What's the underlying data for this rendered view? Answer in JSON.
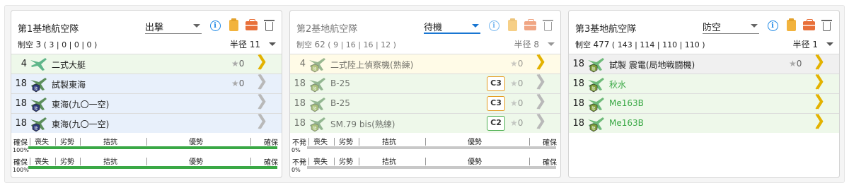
{
  "colors": {
    "gold": "#e3b200",
    "silver": "#b9b9b9",
    "green_bar": "#3aa845",
    "grey_bar": "#c8c8c8",
    "blue_row": "#e8f0fb",
    "green_row": "#eef8ea",
    "yellow_row": "#fffbe7",
    "grey_row": "#f0f0f0"
  },
  "bar_labels": {
    "left": "喪失",
    "l2": "劣勢",
    "mid": "拮抗",
    "m2": "優勢",
    "right": "確保"
  },
  "panels": [
    {
      "title": "第1基地航空隊",
      "mode": "出撃",
      "active": false,
      "air_label": "制空",
      "air_value": "3",
      "air_detail": "( 3 | 0 | 0 | 0 )",
      "radius_label": "半径",
      "radius_value": "11",
      "slots": [
        {
          "count": "4",
          "name": "二式大艇",
          "stars": "0",
          "row": "green",
          "icon": "flying-boat-icon",
          "prof": "gold"
        },
        {
          "count": "18",
          "name": "試製東海",
          "stars": "0",
          "row": "blue",
          "icon": "patrol-plane-icon",
          "prof": "silver"
        },
        {
          "count": "18",
          "name": "東海(九〇一空)",
          "stars": "",
          "row": "blue",
          "icon": "patrol-plane-icon",
          "prof": "silver"
        },
        {
          "count": "18",
          "name": "東海(九〇一空)",
          "stars": "",
          "row": "blue",
          "icon": "patrol-plane-icon",
          "prof": "silver"
        }
      ],
      "bars": [
        {
          "status": "確保",
          "pct": "100%",
          "fill": 1.0,
          "color": "#3aa845"
        },
        {
          "status": "確保",
          "pct": "100%",
          "fill": 1.0,
          "color": "#3aa845"
        }
      ]
    },
    {
      "title": "第2基地航空隊",
      "mode": "待機",
      "active": true,
      "air_label": "制空",
      "air_value": "62",
      "air_detail": "( 9 | 16 | 16 | 12 )",
      "radius_label": "半径",
      "radius_value": "8",
      "slots": [
        {
          "count": "4",
          "name": "二式陸上偵察機(熟練)",
          "stars": "0",
          "row": "yellow",
          "icon": "recon-plane-icon",
          "prof": "gold"
        },
        {
          "count": "18",
          "name": "B-25",
          "stars": "0",
          "row": "green",
          "icon": "land-bomber-icon",
          "prof": "silver",
          "badge": "C3",
          "badge_color": "#e39a1f"
        },
        {
          "count": "18",
          "name": "B-25",
          "stars": "0",
          "row": "green",
          "icon": "land-bomber-icon",
          "prof": "silver",
          "badge": "C3",
          "badge_color": "#e39a1f"
        },
        {
          "count": "18",
          "name": "SM.79 bis(熟練)",
          "stars": "0",
          "row": "green",
          "icon": "land-bomber-icon",
          "prof": "silver",
          "badge": "C2",
          "badge_color": "#4caf50"
        }
      ],
      "bars": [
        {
          "status": "不発",
          "pct": "0%",
          "fill": 1.0,
          "color": "#c8c8c8"
        },
        {
          "status": "不発",
          "pct": "0%",
          "fill": 1.0,
          "color": "#c8c8c8"
        }
      ]
    },
    {
      "title": "第3基地航空隊",
      "mode": "防空",
      "active": false,
      "air_label": "制空",
      "air_value": "477",
      "air_detail": "( 143 | 114 | 110 | 110 )",
      "radius_label": "半径",
      "radius_value": "1",
      "slots": [
        {
          "count": "18",
          "name": "試製 震電(局地戦闘機)",
          "stars": "0",
          "row": "grey",
          "icon": "interceptor-icon",
          "prof": "gold"
        },
        {
          "count": "18",
          "name": "秋水",
          "stars": "",
          "row": "green",
          "icon": "interceptor-icon",
          "prof": "gold",
          "name_color": "#3aa845"
        },
        {
          "count": "18",
          "name": "Me163B",
          "stars": "",
          "row": "green",
          "icon": "interceptor-icon",
          "prof": "gold",
          "name_color": "#3aa845"
        },
        {
          "count": "18",
          "name": "Me163B",
          "stars": "",
          "row": "green",
          "icon": "interceptor-icon",
          "prof": "gold",
          "name_color": "#3aa845"
        }
      ],
      "bars": []
    }
  ]
}
